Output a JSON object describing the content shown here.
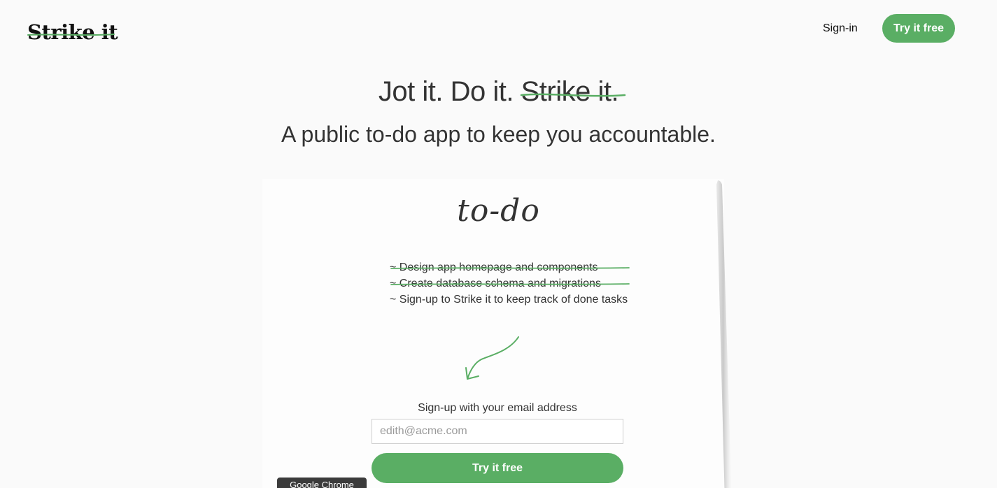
{
  "brand": {
    "logo_text": "Strike it",
    "accent_color": "#5aae64"
  },
  "nav": {
    "signin_label": "Sign-in",
    "cta_label": "Try it free"
  },
  "hero": {
    "title_plain": "Jot it. Do it.",
    "title_struck": "Strike it.",
    "subtitle": "A public to-do app to keep you accountable."
  },
  "todo": {
    "title": "to-do",
    "items": [
      {
        "text": "~ Design app homepage and components",
        "done": true
      },
      {
        "text": "~ Create database schema and migrations",
        "done": true
      },
      {
        "text": "~ Sign-up to Strike it to keep track of done tasks",
        "done": false
      }
    ]
  },
  "signup": {
    "label": "Sign-up with your email address",
    "email_placeholder": "edith@acme.com",
    "email_value": "",
    "cta_label": "Try it free"
  },
  "tooltip": {
    "text": "Google Chrome"
  }
}
